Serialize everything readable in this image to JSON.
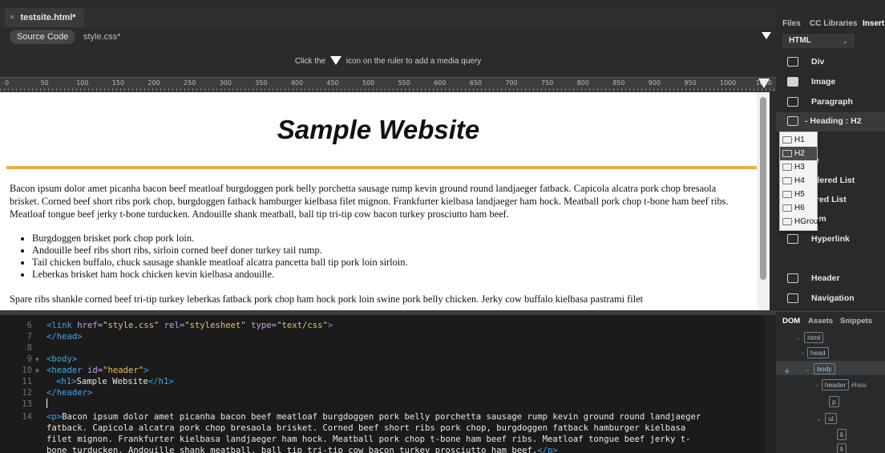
{
  "document": {
    "tab_close": "×",
    "tab_name": "testsite.html*",
    "related_source": "Source Code",
    "related_css": "style.css*",
    "mq_prefix": "Click the",
    "mq_suffix": "icon on the ruler to add a media query",
    "ruler_labels": [
      "0",
      "50",
      "100",
      "150",
      "200",
      "250",
      "300",
      "350",
      "400",
      "450",
      "500",
      "550",
      "600",
      "650",
      "700",
      "750",
      "800",
      "850",
      "900",
      "950",
      "1000",
      "1050"
    ]
  },
  "live": {
    "site_title": "Sample Website",
    "paragraph1": "Bacon ipsum dolor amet picanha bacon beef meatloaf burgdoggen pork belly porchetta sausage rump kevin ground round landjaeger fatback. Capicola alcatra pork chop bresaola brisket. Corned beef short ribs pork chop, burgdoggen fatback hamburger kielbasa filet mignon. Frankfurter kielbasa landjaeger ham hock. Meatball pork chop t-bone ham beef ribs. Meatloaf tongue beef jerky t-bone turducken. Andouille shank meatball, ball tip tri-tip cow bacon turkey prosciutto ham beef.",
    "bullets": [
      "Burgdoggen brisket pork chop pork loin.",
      "Andouille beef ribs short ribs, sirloin corned beef doner turkey tail rump.",
      "Tail chicken buffalo, chuck sausage shankle meatloaf alcatra pancetta ball tip pork loin sirloin.",
      "Leberkas brisket ham hock chicken kevin kielbasa andouille."
    ],
    "paragraph2": "Spare ribs shankle corned beef tri-tip turkey leberkas fatback pork chop ham hock pork loin swine pork belly chicken. Jerky cow buffalo kielbasa pastrami filet"
  },
  "code": {
    "lines": [
      {
        "n": "6",
        "fold": ""
      },
      {
        "n": "7",
        "fold": ""
      },
      {
        "n": "8",
        "fold": ""
      },
      {
        "n": "9",
        "fold": "▼"
      },
      {
        "n": "10",
        "fold": "▼"
      },
      {
        "n": "11",
        "fold": ""
      },
      {
        "n": "12",
        "fold": ""
      },
      {
        "n": "13",
        "fold": ""
      },
      {
        "n": "14",
        "fold": ""
      }
    ],
    "line6_tag_open": "<link ",
    "line6_attr1": "href=",
    "line6_val1": "\"style.css\"",
    "line6_attr2": " rel=",
    "line6_val2": "\"stylesheet\"",
    "line6_attr3": " type=",
    "line6_val3": "\"text/css\"",
    "line6_close": ">",
    "line7": "</head>",
    "line9": "<body>",
    "line10_tag": "<header ",
    "line10_attr": "id=",
    "line10_val": "\"header\"",
    "line10_close": ">",
    "line11_open": "<h1>",
    "line11_text": "Sample Website",
    "line11_close": "</h1>",
    "line12": "</header>",
    "line14_open": "<p>",
    "line14_text_a": "Bacon ipsum dolor amet picanha bacon beef meatloaf burgdoggen pork belly porchetta sausage rump kevin ground round landjaeger",
    "line14_text_b": "fatback. Capicola alcatra pork chop bresaola brisket. Corned beef short ribs pork chop, burgdoggen fatback hamburger kielbasa",
    "line14_text_c": "filet mignon. Frankfurter kielbasa landjaeger ham hock. Meatball pork chop t-bone ham beef ribs. Meatloaf tongue beef jerky t-",
    "line14_text_d": "bone turducken. Andouille shank meatball, ball tip tri-tip cow bacon turkey prosciutto ham beef.",
    "line14_close": "</p>"
  },
  "panel": {
    "tabs": [
      "Files",
      "CC Libraries",
      "Insert"
    ],
    "html_select": "HTML",
    "select_chev": "⌄",
    "insert_items": [
      {
        "label": "Div",
        "icon": "div-icon"
      },
      {
        "label": "Image",
        "icon": "image-icon"
      },
      {
        "label": "Paragraph",
        "icon": "paragraph-icon"
      },
      {
        "label": "- Heading : H2",
        "icon": "heading-icon"
      },
      {
        "label": "e",
        "icon": "table-icon"
      },
      {
        "label": "re",
        "icon": "figure-icon"
      },
      {
        "label": "rdered List",
        "icon": "unordered-list-icon"
      },
      {
        "label": "ered List",
        "icon": "ordered-list-icon"
      },
      {
        "label": "tem",
        "icon": "list-item-icon"
      },
      {
        "label": "Hyperlink",
        "icon": "hyperlink-icon"
      },
      {
        "label": "Header",
        "icon": "header-icon"
      },
      {
        "label": "Navigation",
        "icon": "navigation-icon"
      }
    ],
    "heading_options": [
      "H1",
      "H2",
      "H3",
      "H4",
      "H5",
      "H6",
      "HGroup"
    ],
    "heading_selected": "H2",
    "dom_tabs": [
      "DOM",
      "Assets",
      "Snippets"
    ],
    "dom_nodes": [
      {
        "label": "html",
        "extra": ""
      },
      {
        "label": "head",
        "extra": ""
      },
      {
        "label": "body",
        "extra": ""
      },
      {
        "label": "header",
        "extra": "#hea"
      },
      {
        "label": "p",
        "extra": ""
      },
      {
        "label": "ul",
        "extra": ""
      },
      {
        "label": "li",
        "extra": ""
      },
      {
        "label": "li",
        "extra": ""
      }
    ],
    "dom_plus": "+"
  },
  "colors": {
    "accent_rule": "#e9b14a",
    "tag": "#44a5e8",
    "attr": "#c7a0e8",
    "string": "#e3c06a"
  }
}
